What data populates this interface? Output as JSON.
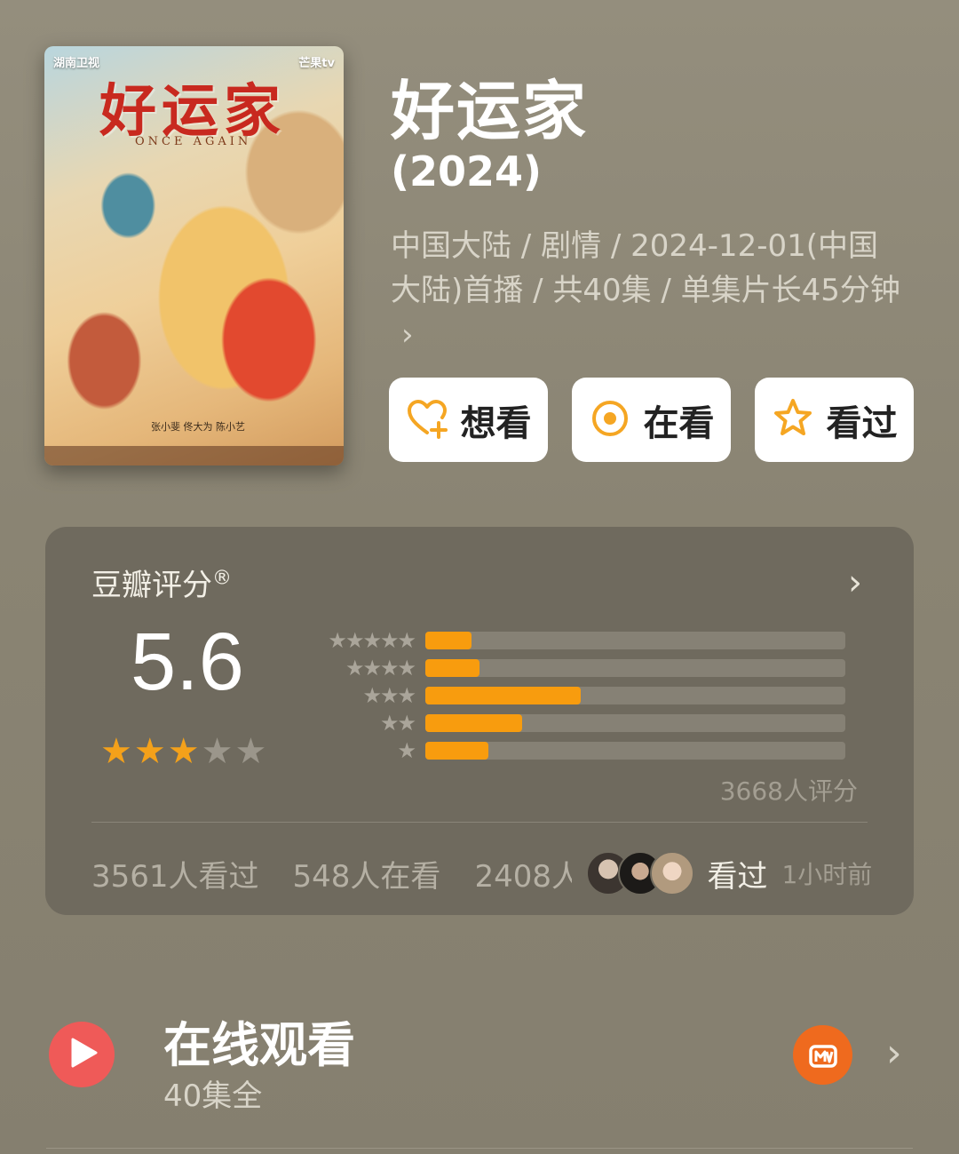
{
  "poster": {
    "title_art": "好运家",
    "subtitle_art": "ONCE AGAIN",
    "logo_left": "湖南卫视",
    "logo_right": "芒果tv",
    "credits": "张小斐 佟大为 陈小艺"
  },
  "show": {
    "title": "好运家",
    "year": "(2024)",
    "meta": "中国大陆 / 剧情 / 2024-12-01(中国大陆)首播 / 共40集 / 单集片长45分钟"
  },
  "actions": {
    "want": "想看",
    "watching": "在看",
    "watched": "看过"
  },
  "rating": {
    "title": "豆瓣评分",
    "registered": "®",
    "score": "5.6",
    "stars_filled": 3,
    "stars_total": 5,
    "distribution": [
      {
        "stars": "★★★★★",
        "fraction": 0.11
      },
      {
        "stars": "★★★★",
        "fraction": 0.13
      },
      {
        "stars": "★★★",
        "fraction": 0.37
      },
      {
        "stars": "★★",
        "fraction": 0.23
      },
      {
        "stars": "★",
        "fraction": 0.15
      }
    ],
    "count": "3668人评分",
    "watched_count": "3561人看过",
    "watching_count": "548人在看",
    "want_count": "2408人想看",
    "friend_action": "看过",
    "friend_time": "1小时前"
  },
  "online": {
    "title": "在线观看",
    "subtitle": "40集全",
    "platform_icon": "mango-tv-icon"
  },
  "colors": {
    "accent": "#f89c0e",
    "play": "#ef5a58",
    "platform": "#ef6a1e"
  }
}
